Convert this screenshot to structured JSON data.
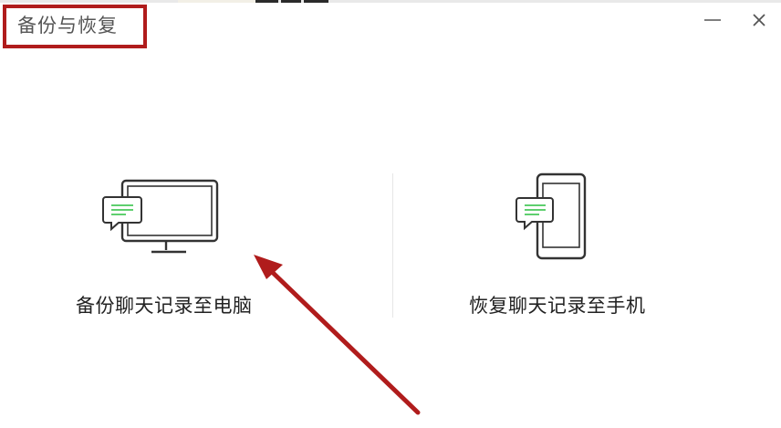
{
  "window": {
    "title": "备份与恢复",
    "minimize_icon": "minimize-icon",
    "close_icon": "close-icon"
  },
  "options": {
    "backup": {
      "label": "备份聊天记录至电脑",
      "icon": "computer-with-chat-icon"
    },
    "restore": {
      "label": "恢复聊天记录至手机",
      "icon": "phone-with-chat-icon"
    }
  },
  "annotation": {
    "highlight_color": "#b01c1c",
    "arrow_color": "#b01c1c"
  },
  "colors": {
    "chat_accent": "#5fcf6f",
    "icon_stroke": "#333333"
  }
}
